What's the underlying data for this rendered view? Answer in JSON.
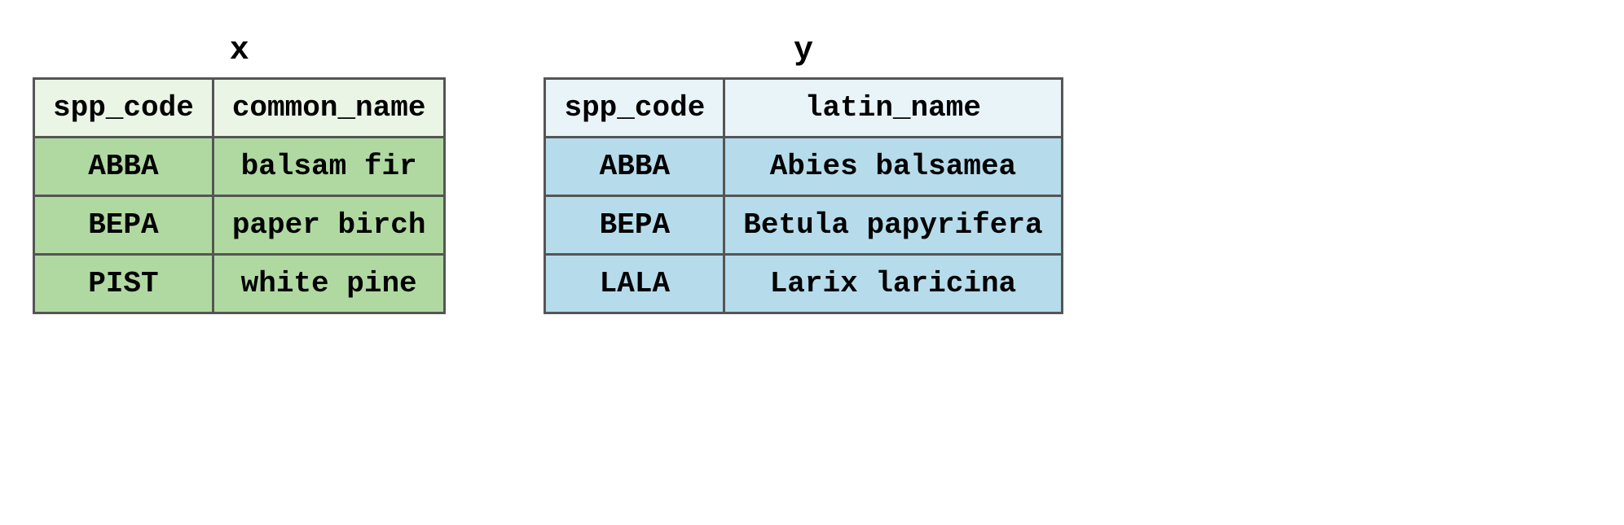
{
  "tables": {
    "x": {
      "title": "x",
      "headers": [
        "spp_code",
        "common_name"
      ],
      "rows": [
        {
          "c0": "ABBA",
          "c1": "balsam fir"
        },
        {
          "c0": "BEPA",
          "c1": "paper birch"
        },
        {
          "c0": "PIST",
          "c1": "white pine"
        }
      ]
    },
    "y": {
      "title": "y",
      "headers": [
        "spp_code",
        "latin_name"
      ],
      "rows": [
        {
          "c0": "ABBA",
          "c1": "Abies balsamea"
        },
        {
          "c0": "BEPA",
          "c1": "Betula papyrifera"
        },
        {
          "c0": "LALA",
          "c1": "Larix laricina"
        }
      ]
    }
  }
}
